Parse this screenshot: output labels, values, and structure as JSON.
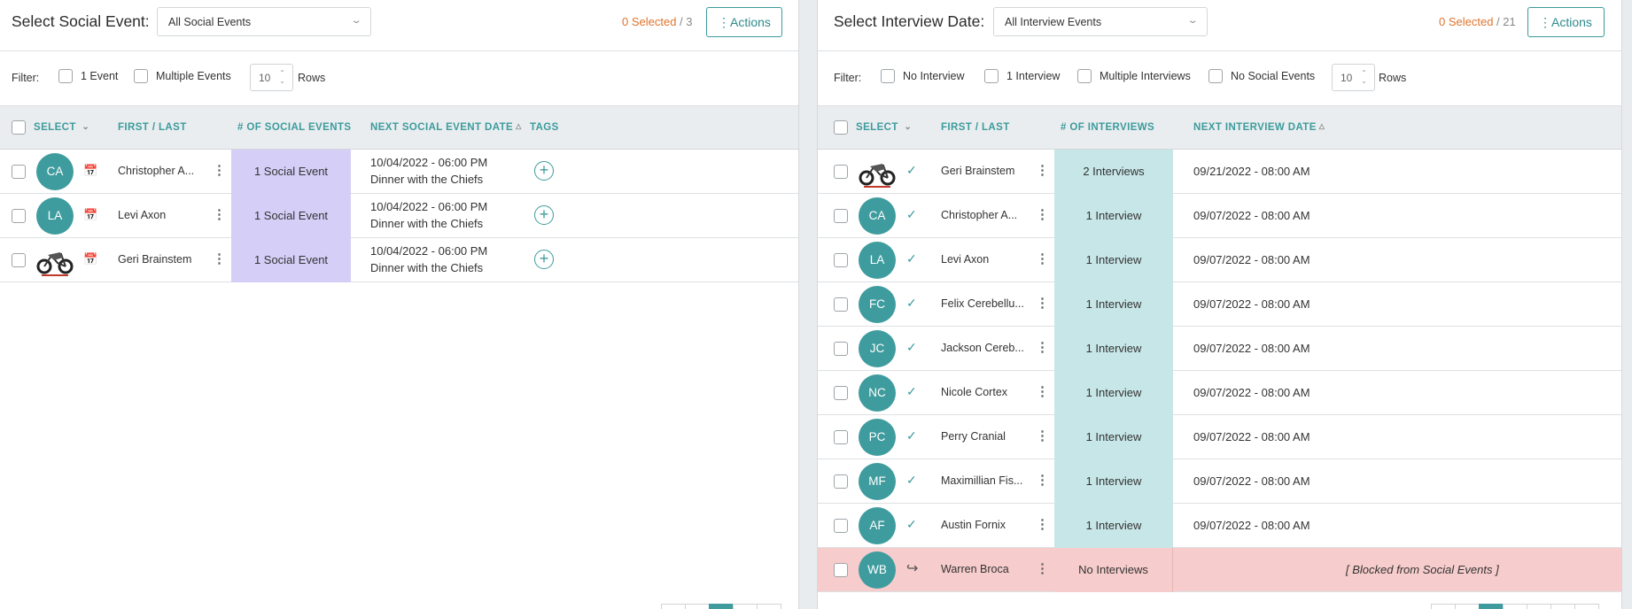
{
  "left": {
    "title": "Select Social Event:",
    "dropdown_value": "All Social Events",
    "selected_count": "0 Selected",
    "selected_total": " / 3",
    "actions_label": "Actions",
    "filter_label": "Filter:",
    "filters": [
      "1 Event",
      "Multiple Events"
    ],
    "rows_value": "10",
    "rows_label": "Rows",
    "columns": [
      "SELECT",
      "FIRST / LAST",
      "# OF SOCIAL EVENTS",
      "NEXT SOCIAL EVENT DATE",
      "TAGS"
    ],
    "rows": [
      {
        "initials": "CA",
        "name": "Christopher A...",
        "count": "1 Social Event",
        "date": "10/04/2022 - 06:00 PM",
        "event": "Dinner with the Chiefs"
      },
      {
        "initials": "LA",
        "name": "Levi Axon",
        "count": "1 Social Event",
        "date": "10/04/2022 - 06:00 PM",
        "event": "Dinner with the Chiefs"
      },
      {
        "initials": "",
        "name": "Geri Brainstem",
        "count": "1 Social Event",
        "date": "10/04/2022 - 06:00 PM",
        "event": "Dinner with the Chiefs"
      }
    ]
  },
  "right": {
    "title": "Select Interview Date:",
    "dropdown_value": "All Interview Events",
    "selected_count": "0 Selected",
    "selected_total": " / 21",
    "actions_label": "Actions",
    "filter_label": "Filter:",
    "filters": [
      "No Interview",
      "1 Interview",
      "Multiple Interviews",
      "No Social Events"
    ],
    "rows_value": "10",
    "rows_label": "Rows",
    "columns": [
      "SELECT",
      "FIRST / LAST",
      "# OF INTERVIEWS",
      "NEXT INTERVIEW DATE"
    ],
    "rows": [
      {
        "initials": "",
        "name": "Geri Brainstem",
        "count": "2 Interviews",
        "date": "09/21/2022 - 08:00 AM"
      },
      {
        "initials": "CA",
        "name": "Christopher A...",
        "count": "1 Interview",
        "date": "09/07/2022 - 08:00 AM"
      },
      {
        "initials": "LA",
        "name": "Levi Axon",
        "count": "1 Interview",
        "date": "09/07/2022 - 08:00 AM"
      },
      {
        "initials": "FC",
        "name": "Felix Cerebellu...",
        "count": "1 Interview",
        "date": "09/07/2022 - 08:00 AM"
      },
      {
        "initials": "JC",
        "name": "Jackson Cereb...",
        "count": "1 Interview",
        "date": "09/07/2022 - 08:00 AM"
      },
      {
        "initials": "NC",
        "name": "Nicole Cortex",
        "count": "1 Interview",
        "date": "09/07/2022 - 08:00 AM"
      },
      {
        "initials": "PC",
        "name": "Perry Cranial",
        "count": "1 Interview",
        "date": "09/07/2022 - 08:00 AM"
      },
      {
        "initials": "MF",
        "name": "Maximillian Fis...",
        "count": "1 Interview",
        "date": "09/07/2022 - 08:00 AM"
      },
      {
        "initials": "AF",
        "name": "Austin Fornix",
        "count": "1 Interview",
        "date": "09/07/2022 - 08:00 AM"
      },
      {
        "initials": "WB",
        "name": "Warren Broca",
        "count": "No Interviews",
        "date": "[ Blocked from Social Events ]"
      }
    ]
  },
  "colors": {
    "teal": "#3f9c9e",
    "orange": "#e0742c",
    "purple_cell": "#d5cef7",
    "teal_cell": "#c7e6e7",
    "blocked": "#f7cccc"
  },
  "icons": {
    "actions": "kebab-icon",
    "dropdown": "chevron-down-icon",
    "social": "calendar-check-icon",
    "interview": "check-icon",
    "blocked": "redirect-arrow-icon",
    "tags": "plus-circle-icon"
  }
}
